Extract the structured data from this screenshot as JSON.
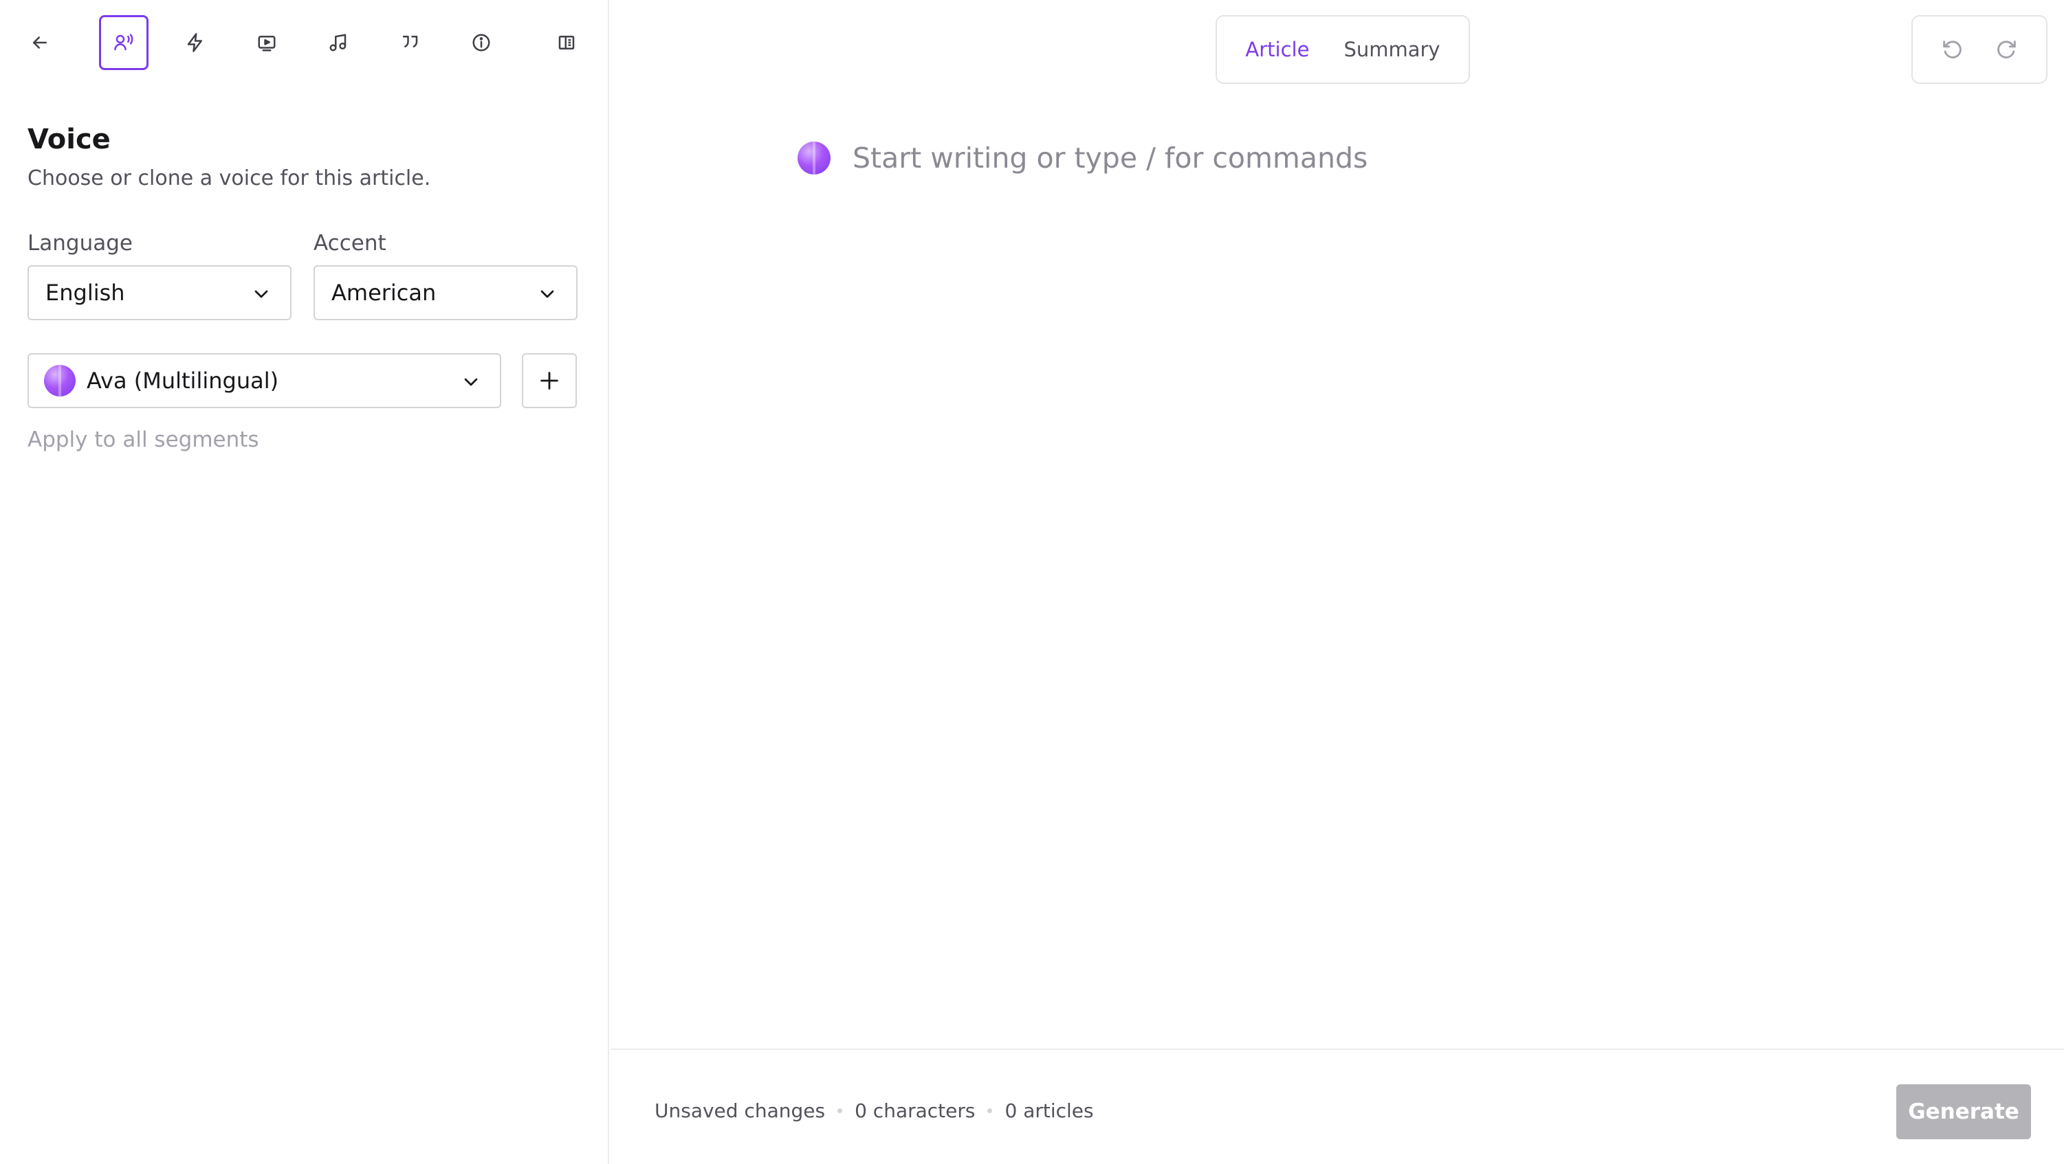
{
  "toolbar": {
    "items": [
      {
        "icon": "arrow-left-icon",
        "active": false
      },
      {
        "icon": "voice-icon",
        "active": true
      },
      {
        "icon": "lightning-icon",
        "active": false
      },
      {
        "icon": "video-icon",
        "active": false
      },
      {
        "icon": "music-note-icon",
        "active": false
      },
      {
        "icon": "quote-icon",
        "active": false
      },
      {
        "icon": "info-icon",
        "active": false
      },
      {
        "icon": "side-panel-icon",
        "active": false
      }
    ]
  },
  "voice_panel": {
    "title": "Voice",
    "subtitle": "Choose or clone a voice for this article.",
    "language_label": "Language",
    "language_value": "English",
    "accent_label": "Accent",
    "accent_value": "American",
    "voice_value": "Ava (Multilingual)",
    "apply_all_label": "Apply to all segments"
  },
  "editor": {
    "tabs": [
      {
        "label": "Article",
        "active": true
      },
      {
        "label": "Summary",
        "active": false
      }
    ],
    "placeholder": "Start writing or type / for commands"
  },
  "footer": {
    "status": "Unsaved changes",
    "characters": "0 characters",
    "articles": "0 articles",
    "generate_label": "Generate"
  },
  "colors": {
    "accent": "#7c3aed",
    "border": "#d4d4d8",
    "muted_text": "#52525b",
    "disabled_button": "#b4b4b8"
  }
}
